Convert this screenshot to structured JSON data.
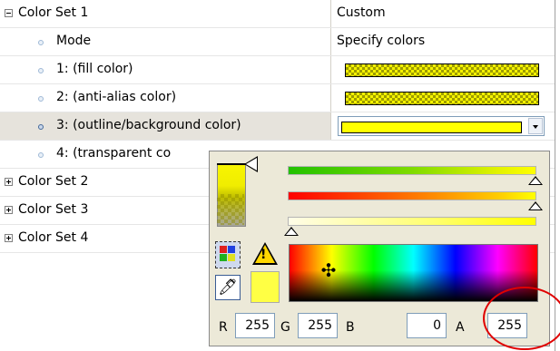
{
  "rows": [
    {
      "label": "Color Set 1",
      "value": "Custom"
    },
    {
      "label": "Mode",
      "value": "Specify colors"
    },
    {
      "label": "1: (fill color)"
    },
    {
      "label": "2: (anti-alias color)"
    },
    {
      "label": "3: (outline/background color)"
    },
    {
      "label": "4: (transparent co"
    },
    {
      "label": "Color Set 2"
    },
    {
      "label": "Color Set 3"
    },
    {
      "label": "Color Set 4"
    }
  ],
  "picker": {
    "warning_symbol": "!",
    "eyedropper_glyph": "🖊",
    "crosshair_glyph": "✣",
    "channels": [
      {
        "label": "R",
        "value": "255"
      },
      {
        "label": "G",
        "value": "255"
      },
      {
        "label": "B",
        "value": "0"
      },
      {
        "label": "A",
        "value": "255"
      }
    ]
  },
  "colors": {
    "selected_color": "#ffff00",
    "highlight_circle": "#e00000"
  }
}
